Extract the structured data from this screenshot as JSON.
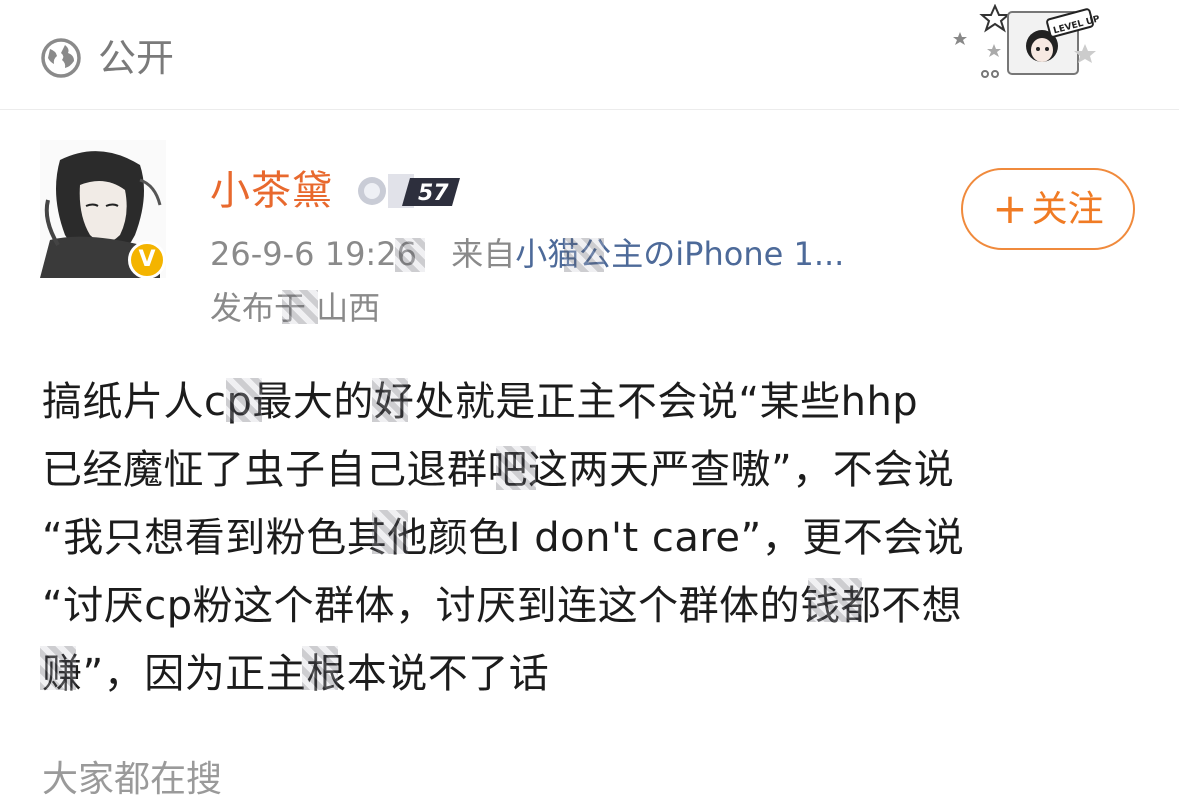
{
  "header": {
    "privacy_label": "公开",
    "sticker_text": "LEVEL UP"
  },
  "post": {
    "author": {
      "name": "小茶黛",
      "level_badge": "57",
      "verified_badge": "V"
    },
    "timestamp": "26-9-6 19:26",
    "source_prefix": "来自",
    "source_device": "小猫公主のiPhone 1...",
    "location_prefix": "发布于",
    "location": "山西",
    "follow_label": "关注",
    "content_lines": [
      "搞纸片人cp最大的好处就是正主不会说“某些hhp",
      "已经魔怔了虫子自己退群吧这两天严查嗷”，不会说",
      "“我只想看到粉色其他颜色I don't care”，更不会说",
      "“讨厌cp粉这个群体，讨厌到连这个群体的钱都不想",
      "赚”，因为正主根本说不了话"
    ]
  },
  "footer": {
    "section_label": "大家都在搜"
  },
  "colors": {
    "accent_orange": "#f07b24",
    "username_orange": "#e8692e",
    "verified_yellow": "#f4b400",
    "meta_gray": "#8a8a8a"
  },
  "icons": [
    "globe-icon",
    "verified-icon",
    "level-icon",
    "plus-icon",
    "sticker-decoration"
  ]
}
